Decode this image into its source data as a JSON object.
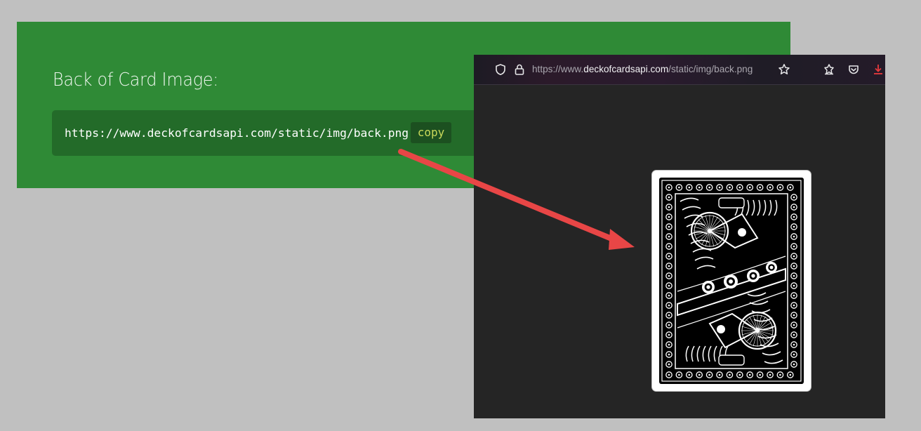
{
  "api_docs": {
    "section_title": "Back of Card Image:",
    "code_url": "https://www.deckofcardsapi.com/static/img/back.png",
    "copy_label": "copy"
  },
  "browser": {
    "url_prefix": "https://www.",
    "url_domain": "deckofcardsapi.com",
    "url_path": "/static/img/back.png",
    "icons": [
      "shield-icon",
      "lock-icon",
      "bookmark-star-icon",
      "extensions-icon",
      "pocket-icon",
      "download-icon"
    ]
  },
  "colors": {
    "page_background": "#c0c0c0",
    "panel_green": "#2f8a36",
    "code_box_green": "#236b29",
    "copy_text": "#c9d95a",
    "arrow_red": "#e84646",
    "download_icon": "#e8393c"
  }
}
